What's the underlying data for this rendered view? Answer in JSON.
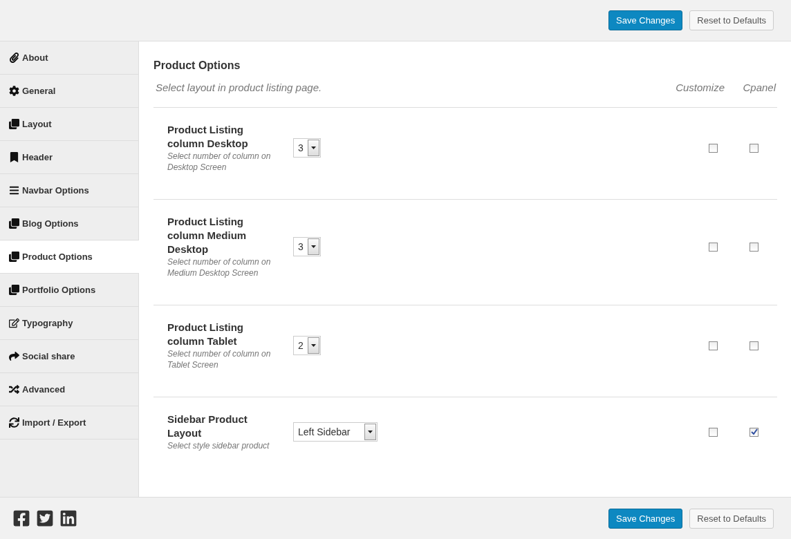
{
  "header": {
    "buttons": [
      {
        "label": "Save Changes",
        "kind": "primary"
      },
      {
        "label": "Reset to Defaults",
        "kind": "secondary"
      }
    ]
  },
  "sidebar": {
    "items": [
      {
        "label": "About",
        "selected": false
      },
      {
        "label": "General",
        "selected": false
      },
      {
        "label": "Layout",
        "selected": false
      },
      {
        "label": "Header",
        "selected": false
      },
      {
        "label": "Navbar Options",
        "selected": false
      },
      {
        "label": "Blog Options",
        "selected": false
      },
      {
        "label": "Product Options",
        "selected": true
      },
      {
        "label": "Portfolio Options",
        "selected": false
      },
      {
        "label": "Typography",
        "selected": false
      },
      {
        "label": "Social share",
        "selected": false
      },
      {
        "label": "Advanced",
        "selected": false
      },
      {
        "label": "Import / Export",
        "selected": false
      }
    ]
  },
  "section": {
    "title": "Product Options",
    "subtitle": "Select layout in product listing page.",
    "columns": [
      "Customize",
      "Cpanel"
    ],
    "rows": [
      {
        "title": "Product Listing column Desktop",
        "description": "Select number of column on Desktop Screen",
        "value": "3",
        "customize": false,
        "cpanel": false
      },
      {
        "title": "Product Listing column Medium Desktop",
        "description": "Select number of column on Medium Desktop Screen",
        "value": "3",
        "customize": false,
        "cpanel": false
      },
      {
        "title": "Product Listing column Tablet",
        "description": "Select number of column on Tablet Screen",
        "value": "2",
        "customize": false,
        "cpanel": false
      },
      {
        "title": "Sidebar Product Layout",
        "description": "Select style sidebar product",
        "value": "Left Sidebar",
        "customize": false,
        "cpanel": true
      }
    ]
  },
  "footer": {
    "buttons": [
      {
        "label": "Save Changes",
        "kind": "primary"
      },
      {
        "label": "Reset to Defaults",
        "kind": "secondary"
      }
    ]
  }
}
